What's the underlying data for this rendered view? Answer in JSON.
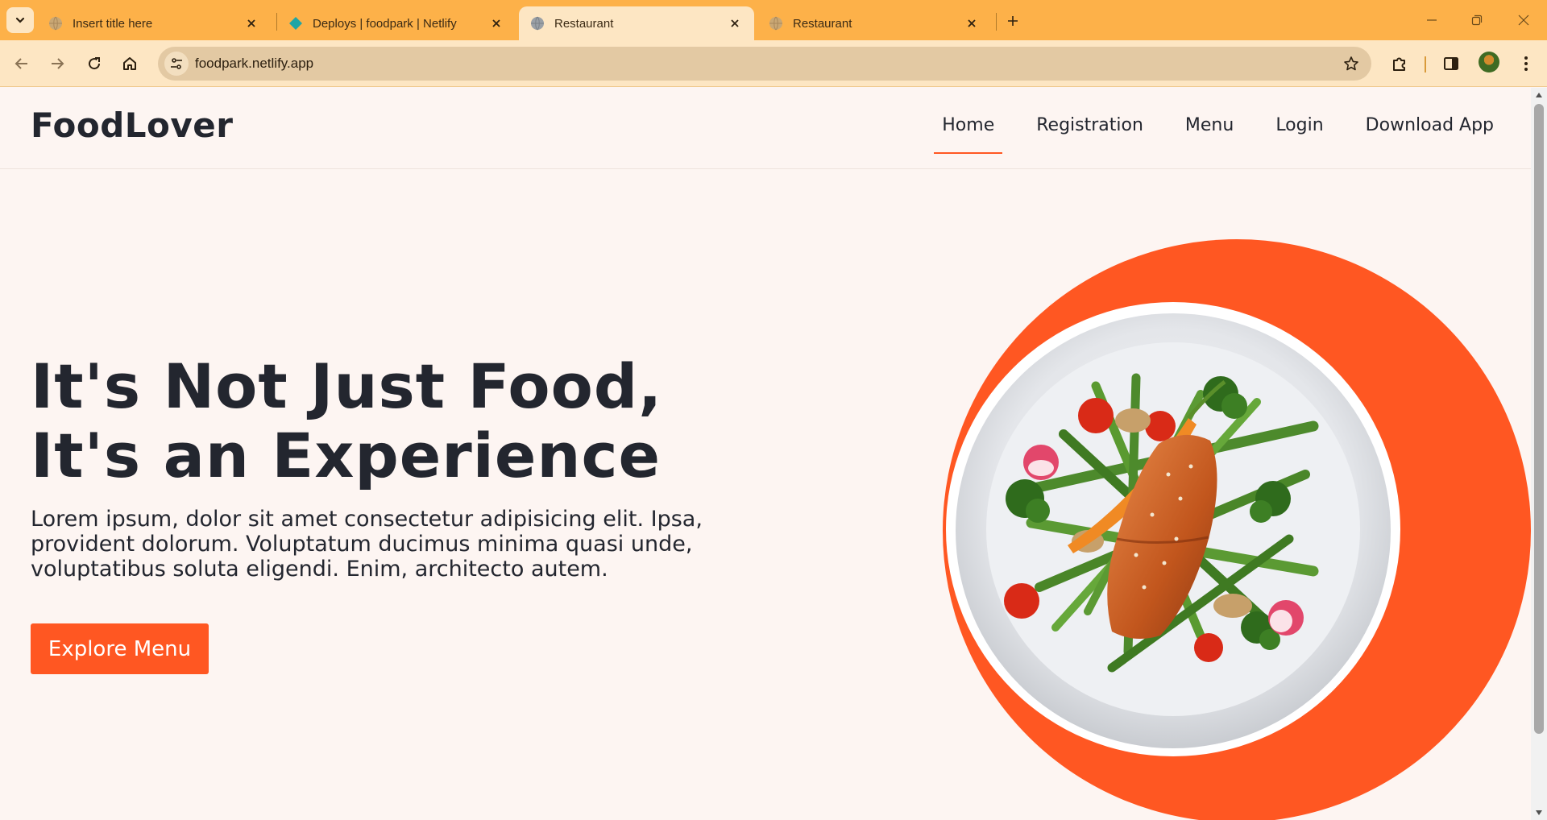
{
  "browser": {
    "tabs": [
      {
        "title": "Insert title here",
        "favicon": "globe-icon"
      },
      {
        "title": "Deploys | foodpark | Netlify",
        "favicon": "netlify-icon"
      },
      {
        "title": "Restaurant",
        "favicon": "globe-icon",
        "active": true
      },
      {
        "title": "Restaurant",
        "favicon": "globe-icon"
      }
    ],
    "url": "foodpark.netlify.app",
    "accent": "#fdb149"
  },
  "site": {
    "logo": "FoodLover",
    "nav": [
      "Home",
      "Registration",
      "Menu",
      "Login",
      "Download App"
    ],
    "active_nav": "Home",
    "hero": {
      "title_line1": "It's Not Just Food,",
      "title_line2": "It's an Experience",
      "text": "Lorem ipsum, dolor sit amet consectetur adipisicing elit. Ipsa, provident dolorum. Voluptatum ducimus minima quasi unde, voluptatibus soluta eligendi. Enim, architecto autem.",
      "cta": "Explore Menu"
    },
    "brand_color": "#ff5722",
    "text_color": "#23262f"
  }
}
